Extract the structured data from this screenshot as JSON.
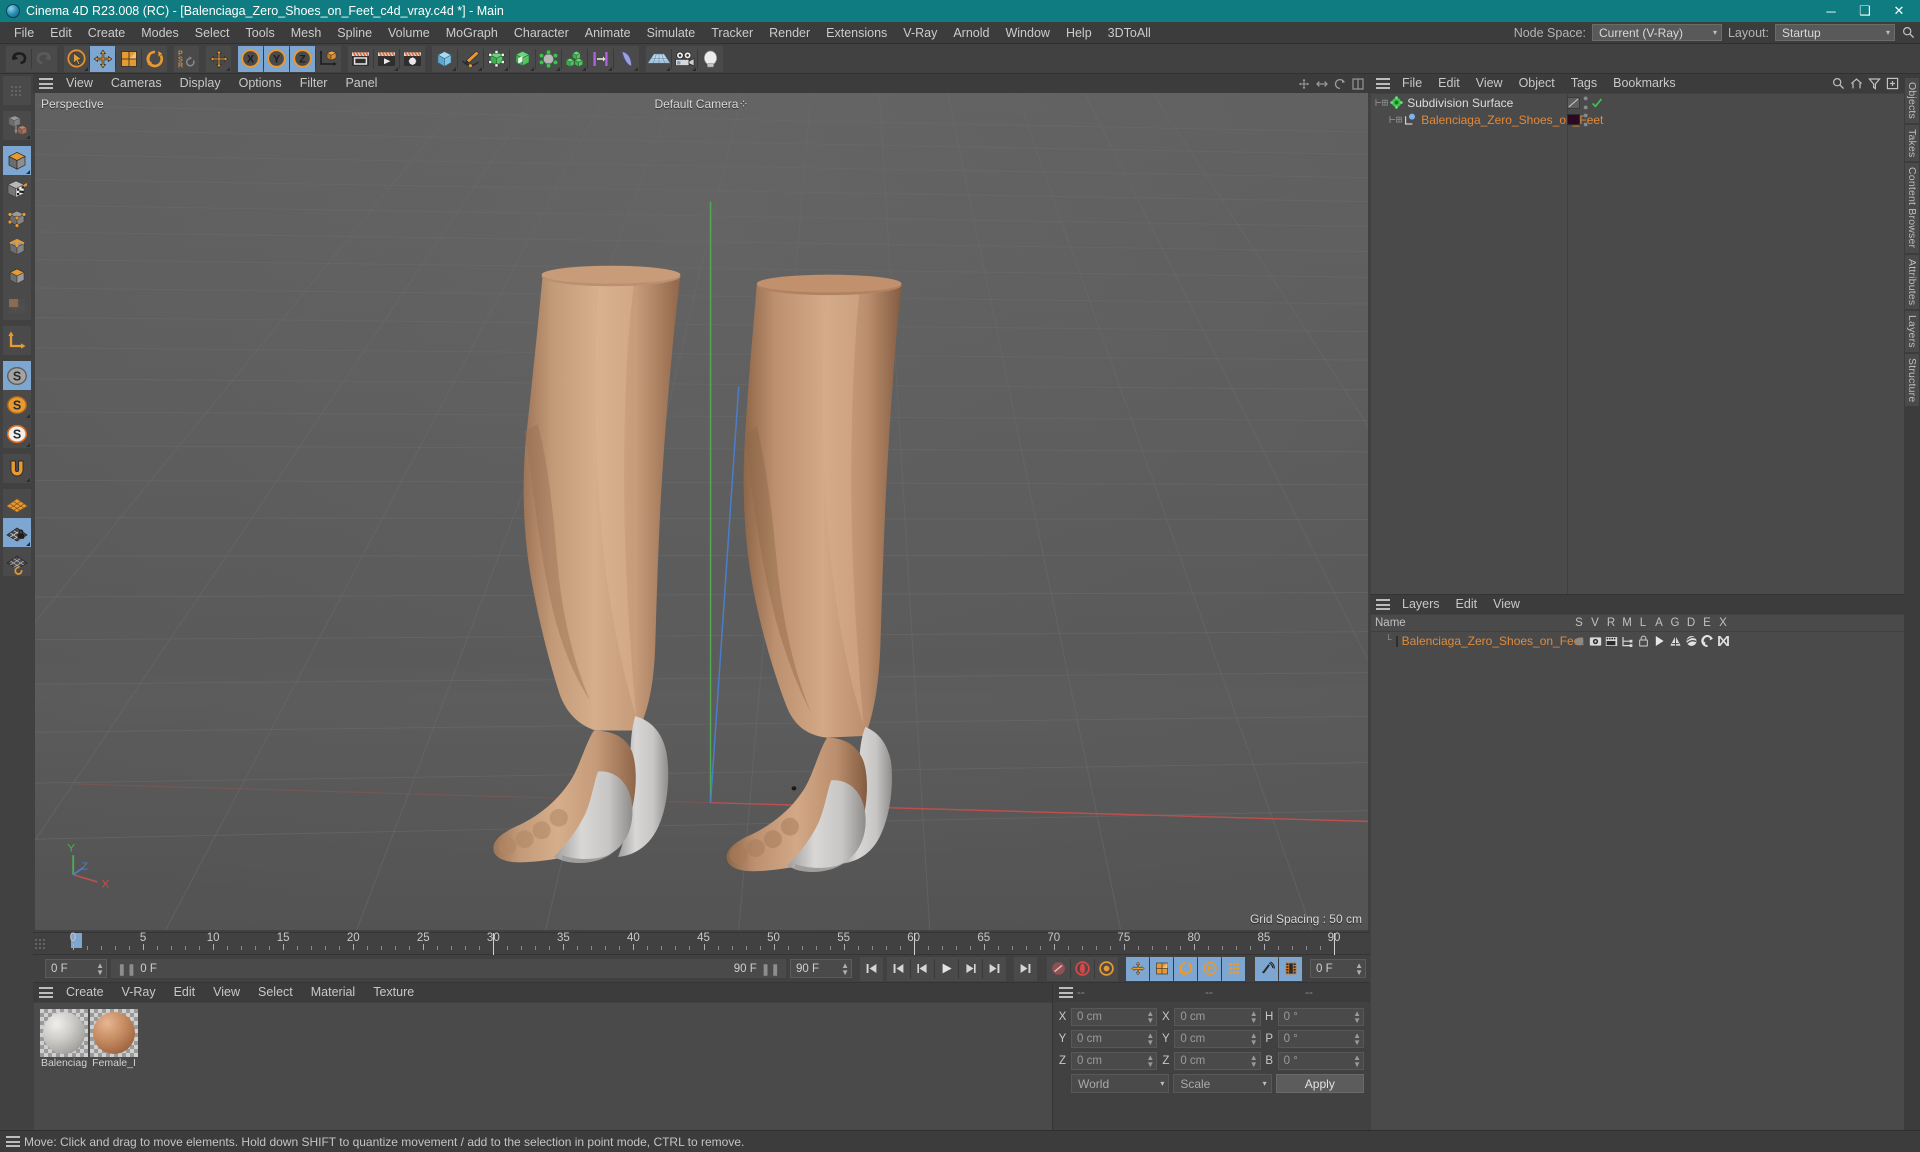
{
  "titlebar": {
    "app_title": "Cinema 4D R23.008 (RC) - [Balenciaga_Zero_Shoes_on_Feet_c4d_vray.c4d *] - Main",
    "logo_icon": "c4d-logo-icon",
    "minimize": "─",
    "maximize": "❑",
    "close": "✕",
    "accent": "#0e7c80"
  },
  "menubar": {
    "items": [
      "File",
      "Edit",
      "Create",
      "Modes",
      "Select",
      "Tools",
      "Mesh",
      "Spline",
      "Volume",
      "MoGraph",
      "Character",
      "Animate",
      "Simulate",
      "Tracker",
      "Render",
      "Extensions",
      "V-Ray",
      "Arnold",
      "Window",
      "Help",
      "3DToAll"
    ],
    "node_space_label": "Node Space:",
    "node_space_value": "Current (V-Ray)",
    "layout_label": "Layout:",
    "layout_value": "Startup",
    "search_icon": "search-icon"
  },
  "toolbar": {
    "groups": [
      {
        "name": "history",
        "buttons": [
          {
            "name": "undo-button",
            "icon": "undo-icon",
            "state": "on_enabled"
          },
          {
            "name": "redo-button",
            "icon": "redo-icon",
            "state": "disabled"
          }
        ]
      },
      {
        "name": "transform-tools",
        "buttons": [
          {
            "name": "select-tool",
            "icon": "live-selection-icon",
            "state": "corner"
          },
          {
            "name": "move-tool",
            "icon": "move-icon",
            "state": "active"
          },
          {
            "name": "scale-tool",
            "icon": "scale-icon",
            "state": "normal"
          },
          {
            "name": "rotate-tool",
            "icon": "rotate-icon",
            "state": "normal"
          }
        ]
      },
      {
        "name": "psr",
        "buttons": [
          {
            "name": "psr-toggle",
            "icon": "psr-icon",
            "state": "normal"
          }
        ]
      },
      {
        "name": "world-object-axis",
        "buttons": [
          {
            "name": "world-axis-button",
            "icon": "move-axis-icon",
            "state": "corner"
          }
        ]
      },
      {
        "name": "axis-locks",
        "buttons": [
          {
            "name": "lock-x-axis",
            "icon": "x-axis-icon",
            "label": "X",
            "state": "active"
          },
          {
            "name": "lock-y-axis",
            "icon": "y-axis-icon",
            "label": "Y",
            "state": "active"
          },
          {
            "name": "lock-z-axis",
            "icon": "z-axis-icon",
            "label": "Z",
            "state": "active"
          },
          {
            "name": "world-coordinate-system",
            "icon": "world-coords-icon",
            "state": "normal"
          }
        ]
      },
      {
        "name": "render-tools",
        "buttons": [
          {
            "name": "render-view-button",
            "icon": "render-view-icon",
            "state": "normal"
          },
          {
            "name": "render-to-picture-viewer-button",
            "icon": "render-picture-viewer-icon",
            "state": "corner"
          },
          {
            "name": "render-settings-button",
            "icon": "render-settings-icon",
            "state": "normal"
          }
        ]
      },
      {
        "name": "creation-tools",
        "buttons": [
          {
            "name": "add-primitive-button",
            "icon": "cube-primitive-icon",
            "state": "corner"
          },
          {
            "name": "add-spline-button",
            "icon": "pen-spline-icon",
            "state": "corner"
          },
          {
            "name": "add-generator-button",
            "icon": "nurbs-generator-icon",
            "state": "corner"
          },
          {
            "name": "add-bend-deformer-button",
            "icon": "deformer-icon",
            "state": "corner"
          },
          {
            "name": "add-scene-object-button",
            "icon": "scene-environment-icon",
            "state": "corner"
          },
          {
            "name": "add-mograph-button",
            "icon": "mograph-cloner-icon",
            "state": "corner"
          },
          {
            "name": "add-measure-tool-button",
            "icon": "measure-construct-icon",
            "state": "corner"
          },
          {
            "name": "add-deformer-button",
            "icon": "bend-deformer-icon",
            "state": "corner"
          }
        ]
      },
      {
        "name": "scene-objects",
        "buttons": [
          {
            "name": "add-floor-button",
            "icon": "floor-environment-icon",
            "state": "corner"
          },
          {
            "name": "add-camera-button",
            "icon": "camera-icon",
            "state": "corner"
          },
          {
            "name": "add-light-button",
            "icon": "light-bulb-icon",
            "state": "corner"
          }
        ]
      }
    ]
  },
  "left_toolbar": {
    "groups": [
      {
        "buttons": [
          {
            "name": "tool-handle-dots",
            "icon": "drag-dots-icon",
            "state": "normal"
          }
        ]
      },
      {
        "buttons": [
          {
            "name": "make-editable-button",
            "icon": "make-editable-icon",
            "state": "corner"
          }
        ]
      },
      {
        "buttons": [
          {
            "name": "model-mode-button",
            "icon": "model-mode-icon",
            "state": "active"
          },
          {
            "name": "texture-mode-button",
            "icon": "texture-mode-icon",
            "state": "normal"
          },
          {
            "name": "points-mode-button",
            "icon": "points-mode-icon",
            "state": "normal"
          },
          {
            "name": "edges-mode-button",
            "icon": "edges-mode-icon",
            "state": "normal"
          },
          {
            "name": "polygons-mode-button",
            "icon": "polygons-mode-icon",
            "state": "normal"
          },
          {
            "name": "uv-mode-button",
            "icon": "uv-mode-icon",
            "state": "disabled"
          }
        ]
      },
      {
        "buttons": [
          {
            "name": "enable-axis-modification-button",
            "icon": "axis-modify-icon",
            "state": "normal"
          }
        ]
      },
      {
        "buttons": [
          {
            "name": "snap-settings-button",
            "icon": "snap-s-grey-icon",
            "state": "active"
          },
          {
            "name": "quantize-button",
            "icon": "snap-s-orange-icon",
            "state": "corner"
          },
          {
            "name": "snap-enable-button",
            "icon": "snap-s-white-icon",
            "state": "corner"
          }
        ]
      },
      {
        "buttons": [
          {
            "name": "magnet-tool-button",
            "icon": "magnet-icon",
            "state": "corner"
          }
        ]
      },
      {
        "buttons": [
          {
            "name": "workplane-button",
            "icon": "workplane-orange-icon",
            "state": "normal"
          },
          {
            "name": "lock-workplane-button",
            "icon": "workplane-lock-icon",
            "state": "active"
          },
          {
            "name": "planar-workplane-button",
            "icon": "workplane-rotate-icon",
            "state": "normal"
          }
        ]
      }
    ]
  },
  "viewport": {
    "menu_items": [
      "View",
      "Cameras",
      "Display",
      "Options",
      "Filter",
      "Panel"
    ],
    "hamburger_icon": "hamburger-icon",
    "corner_icons": [
      "move-viewport-icon",
      "zoom-viewport-icon",
      "rotate-viewport-icon",
      "maximize-viewport-icon"
    ],
    "label_projection": "Perspective",
    "label_camera": "Default Camera",
    "label_camera_badge": "⁘",
    "grid_spacing": "Grid Spacing : 50 cm",
    "axis_labels": {
      "y": "Y",
      "x": "X",
      "z": "Z"
    },
    "bg_color": "#5a5a5a",
    "grid_line_color": "#6e6e6e",
    "axis_x_color": "#c0504d",
    "axis_y_color": "#4fae4f",
    "axis_z_color": "#4a7fd0",
    "model_skin_color": "#c49a7b",
    "model_shoe_color": "#d4d2d0"
  },
  "timeline": {
    "ticks": [
      0,
      5,
      10,
      15,
      20,
      25,
      30,
      35,
      40,
      45,
      50,
      55,
      60,
      65,
      70,
      75,
      80,
      85,
      90
    ],
    "range_start": 0,
    "range_end": 90,
    "current_frame_label": "0 F",
    "current_frame_spin": "0 F",
    "range_left_label": "0 F",
    "range_right_label": "90 F",
    "end_frame_spin": "90 F",
    "preview_frame_field": "0 F",
    "transport_buttons": [
      {
        "name": "go-to-start-button",
        "icon": "skip-start-icon"
      },
      {
        "name": "go-to-previous-key-button",
        "icon": "prev-key-icon"
      },
      {
        "name": "go-to-previous-frame-button",
        "icon": "step-back-icon"
      },
      {
        "name": "play-button",
        "icon": "play-icon"
      },
      {
        "name": "go-to-next-frame-button",
        "icon": "step-forward-icon"
      },
      {
        "name": "go-to-next-key-button",
        "icon": "next-key-icon"
      },
      {
        "name": "go-to-end-button",
        "icon": "skip-end-icon"
      }
    ],
    "record_buttons": [
      {
        "name": "record-active-objects-button",
        "icon": "record-keyframe-icon"
      },
      {
        "name": "autokeying-button",
        "icon": "autokey-icon"
      },
      {
        "name": "keyframe-selection-button",
        "icon": "key-selection-icon"
      }
    ],
    "pos_scale_rot_param": [
      {
        "name": "record-position-button",
        "icon": "position-key-icon",
        "label": ""
      },
      {
        "name": "record-scale-button",
        "icon": "scale-key-icon",
        "label": ""
      },
      {
        "name": "record-rotation-button",
        "icon": "rotation-key-icon",
        "label": ""
      },
      {
        "name": "record-param-button",
        "icon": "param-key-icon",
        "label": "P"
      },
      {
        "name": "record-pla-button",
        "icon": "pla-key-icon",
        "label": ""
      }
    ],
    "right_buttons": [
      {
        "name": "dynamics-playback-button",
        "icon": "dynamics-icon"
      },
      {
        "name": "timeline-settings-button",
        "icon": "timeline-settings-icon"
      }
    ]
  },
  "material_manager": {
    "menu_items": [
      "Create",
      "V-Ray",
      "Edit",
      "View",
      "Select",
      "Material",
      "Texture"
    ],
    "hamburger_icon": "hamburger-icon",
    "materials": [
      {
        "name": "Balenciaga",
        "label": "Balenciag",
        "color": "#b9b9b6",
        "selected": false
      },
      {
        "name": "Female_Body",
        "label": "Female_I",
        "color": "#b5764a",
        "selected": false
      }
    ]
  },
  "coordinates": {
    "hamburger_icon": "hamburger-icon",
    "header_cols": [
      "--",
      "--",
      "--"
    ],
    "rows": [
      {
        "axis1": "X",
        "v1": "0 cm",
        "axis2": "X",
        "v2": "0 cm",
        "axis3": "H",
        "v3": "0 °"
      },
      {
        "axis1": "Y",
        "v1": "0 cm",
        "axis2": "Y",
        "v2": "0 cm",
        "axis3": "P",
        "v3": "0 °"
      },
      {
        "axis1": "Z",
        "v1": "0 cm",
        "axis2": "Z",
        "v2": "0 cm",
        "axis3": "B",
        "v3": "0 °"
      }
    ],
    "space_value": "World",
    "mode_value": "Scale",
    "apply_label": "Apply"
  },
  "object_manager": {
    "menu_items": [
      "File",
      "Edit",
      "View",
      "Object",
      "Tags",
      "Bookmarks"
    ],
    "hamburger_icon": "hamburger-icon",
    "header_icons": [
      "search-icon",
      "home-icon",
      "filter-icon",
      "add-layer-icon"
    ],
    "rows": [
      {
        "name": "Subdivision Surface",
        "indent": 0,
        "icon": "subdivision-surface-icon",
        "expander": "⊞",
        "tags": [
          "display-tag-icon",
          "check-icon"
        ],
        "color": "#dcdcdc",
        "swatch": ""
      },
      {
        "name": "Balenciaga_Zero_Shoes_on_Feet",
        "indent": 1,
        "icon": "polygon-object-icon",
        "expander": "⊞",
        "tags": [
          "material-tag-swatch"
        ],
        "color": "#e08a3c",
        "swatch": "#2b0a21"
      }
    ]
  },
  "layers_manager": {
    "menu_items": [
      "Layers",
      "Edit",
      "View"
    ],
    "hamburger_icon": "hamburger-icon",
    "columns": [
      "Name",
      "S",
      "V",
      "R",
      "M",
      "L",
      "A",
      "G",
      "D",
      "E",
      "X"
    ],
    "rows": [
      {
        "name": "Balenciaga_Zero_Shoes_on_Feet",
        "swatch": "#2b0a21",
        "color": "#e08a3c",
        "icons": [
          "solo-dot-icon",
          "visible-eye-icon",
          "render-film-icon",
          "manager-tree-icon",
          "lock-icon",
          "animation-play-icon",
          "generators-icon",
          "deformers-icon",
          "expressions-icon",
          "xref-icon"
        ]
      }
    ]
  },
  "right_tabs": [
    "Objects",
    "Takes",
    "Content Browser",
    "Attributes",
    "Layers",
    "Structure"
  ],
  "statusbar": {
    "hamburger_icon": "hamburger-icon",
    "message": "Move: Click and drag to move elements. Hold down SHIFT to quantize movement / add to the selection in point mode, CTRL to remove."
  }
}
